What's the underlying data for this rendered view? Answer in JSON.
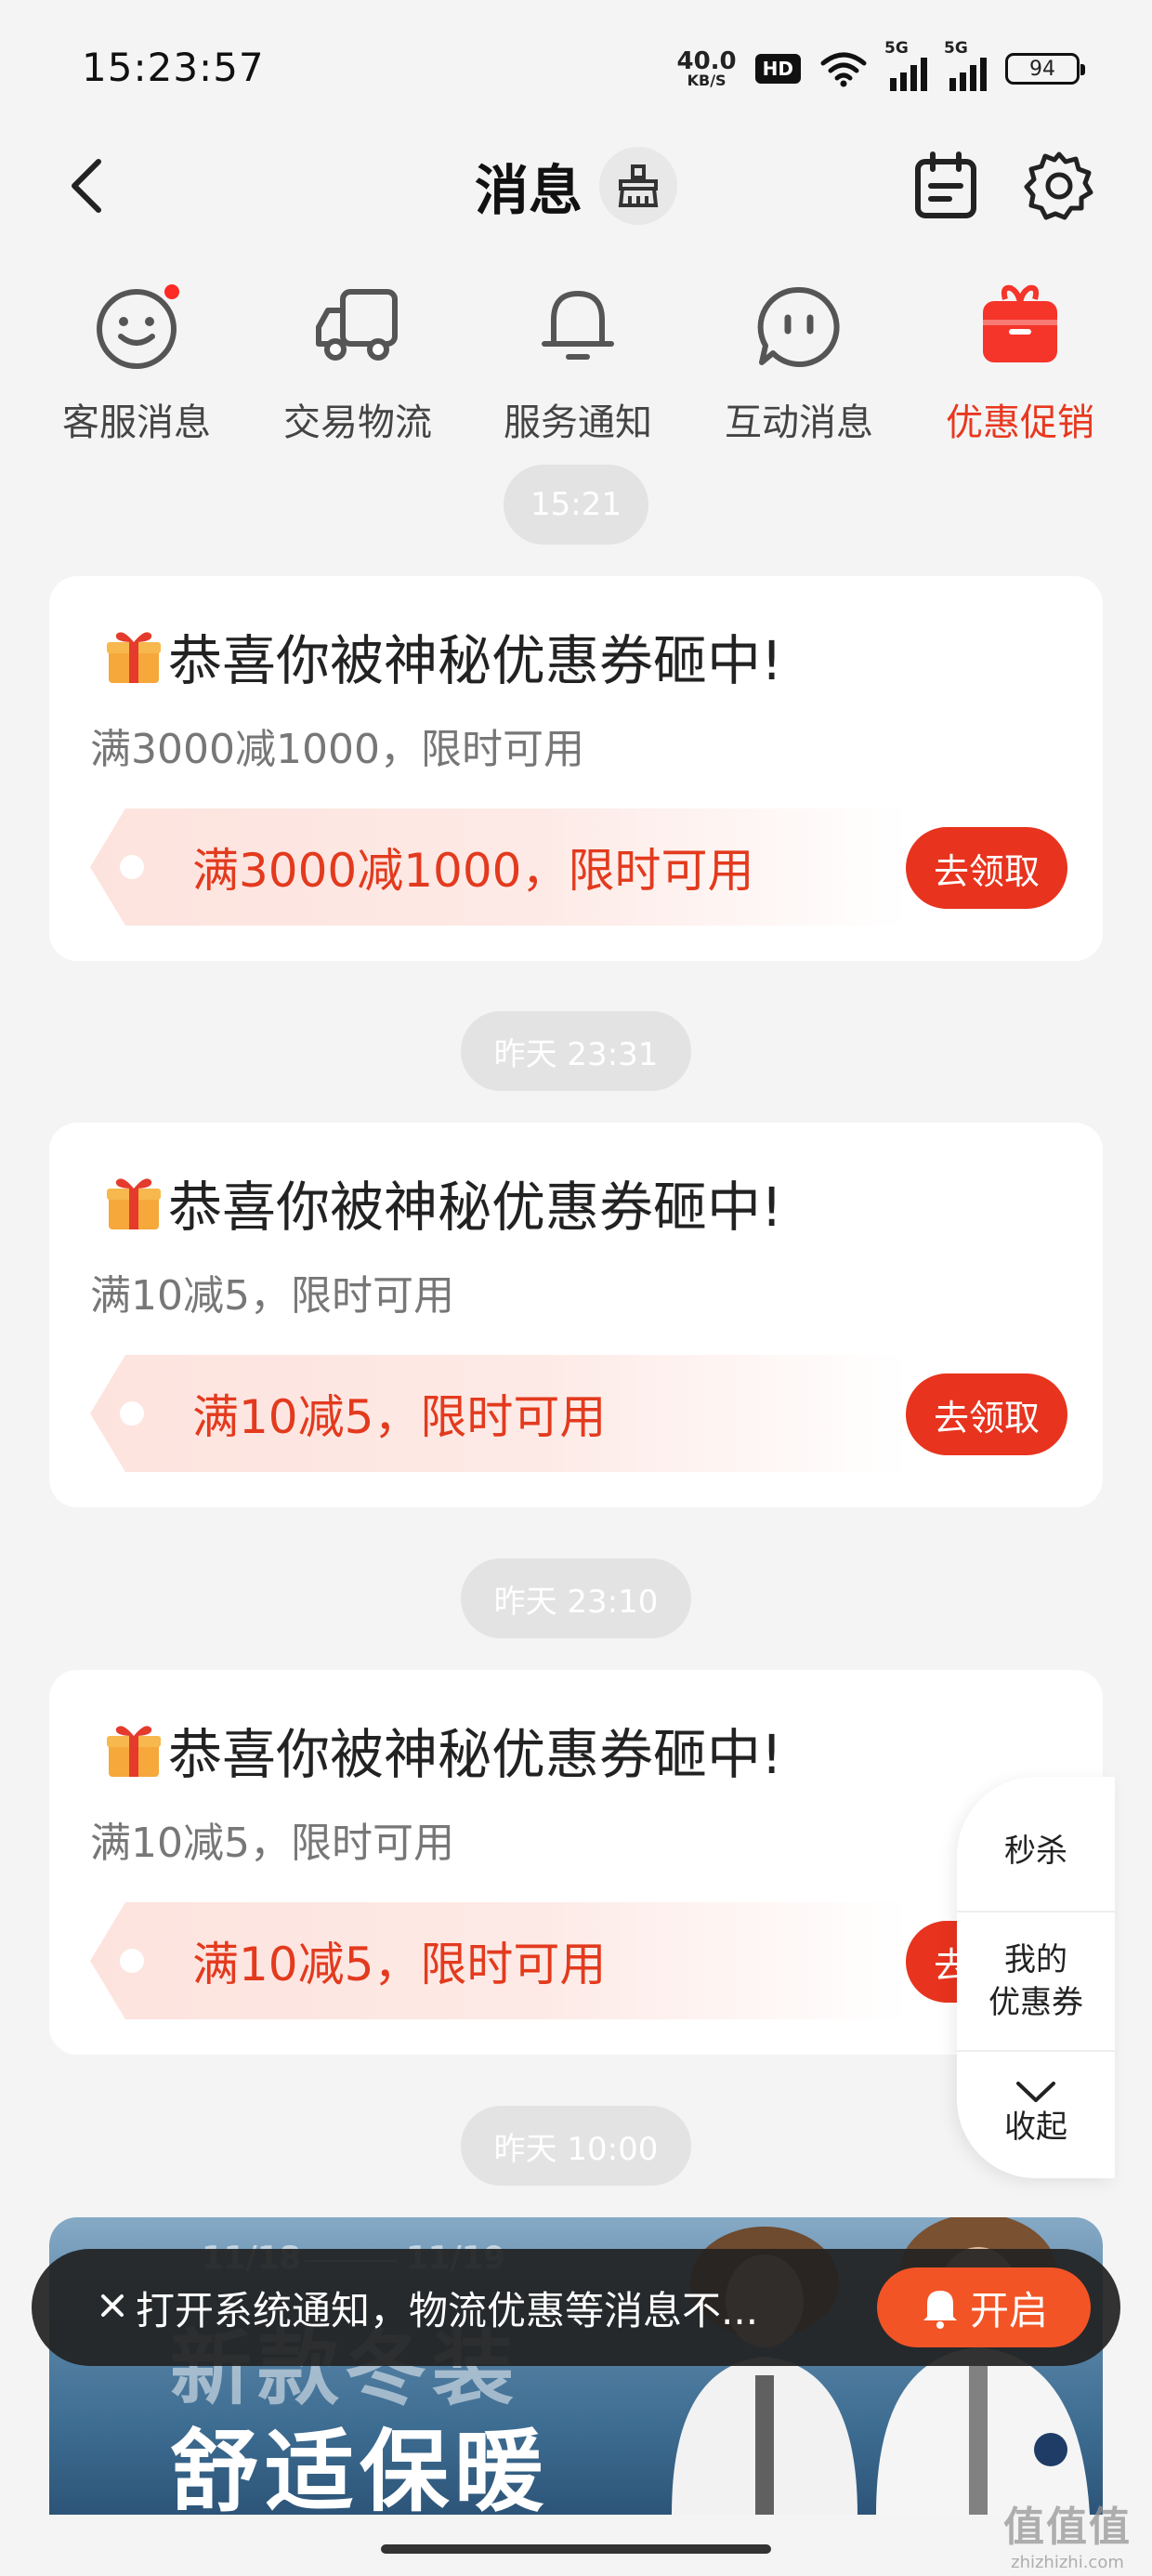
{
  "status_bar": {
    "time": "15:23:57",
    "net_speed_value": "40.0",
    "net_speed_unit": "KB/S",
    "hd_label": "HD",
    "signal1_label": "5G",
    "signal2_label": "5G",
    "battery": "94"
  },
  "header": {
    "title": "消息"
  },
  "categories": [
    {
      "label": "客服消息",
      "icon": "smiley-chat-icon",
      "has_dot": true
    },
    {
      "label": "交易物流",
      "icon": "truck-icon"
    },
    {
      "label": "服务通知",
      "icon": "bell-icon"
    },
    {
      "label": "互动消息",
      "icon": "chat-bubble-icon"
    },
    {
      "label": "优惠促销",
      "icon": "gift-icon",
      "active": true
    }
  ],
  "messages": [
    {
      "time": "15:21",
      "title": "恭喜你被神秘优惠券砸中!",
      "subtitle": "满3000减1000，限时可用",
      "coupon_text": "满3000减1000，限时可用",
      "button": "去领取"
    },
    {
      "time": "昨天 23:31",
      "title": "恭喜你被神秘优惠券砸中!",
      "subtitle": "满10减5，限时可用",
      "coupon_text": "满10减5，限时可用",
      "button": "去领取"
    },
    {
      "time": "昨天 23:10",
      "title": "恭喜你被神秘优惠券砸中!",
      "subtitle": "满10减5，限时可用",
      "coupon_text": "满10减5，限时可用",
      "button": "去领"
    }
  ],
  "last_time": "昨天 10:00",
  "side_panel": {
    "flash_sale": "秒杀",
    "my_coupons_line1": "我的",
    "my_coupons_line2": "优惠券",
    "collapse": "收起"
  },
  "banner": {
    "date_start": "11/18",
    "date_end": "11/19",
    "headline_faded": "新款冬装",
    "headline": "舒适保暖"
  },
  "toast": {
    "text": "打开系统通知，物流优惠等消息不...",
    "button": "开启"
  },
  "watermark": {
    "logo": "值值值",
    "site": "zhizhizhi.com"
  },
  "colors": {
    "accent": "#e8331e",
    "background": "#f4f4f4",
    "toast_button": "#f25426"
  }
}
